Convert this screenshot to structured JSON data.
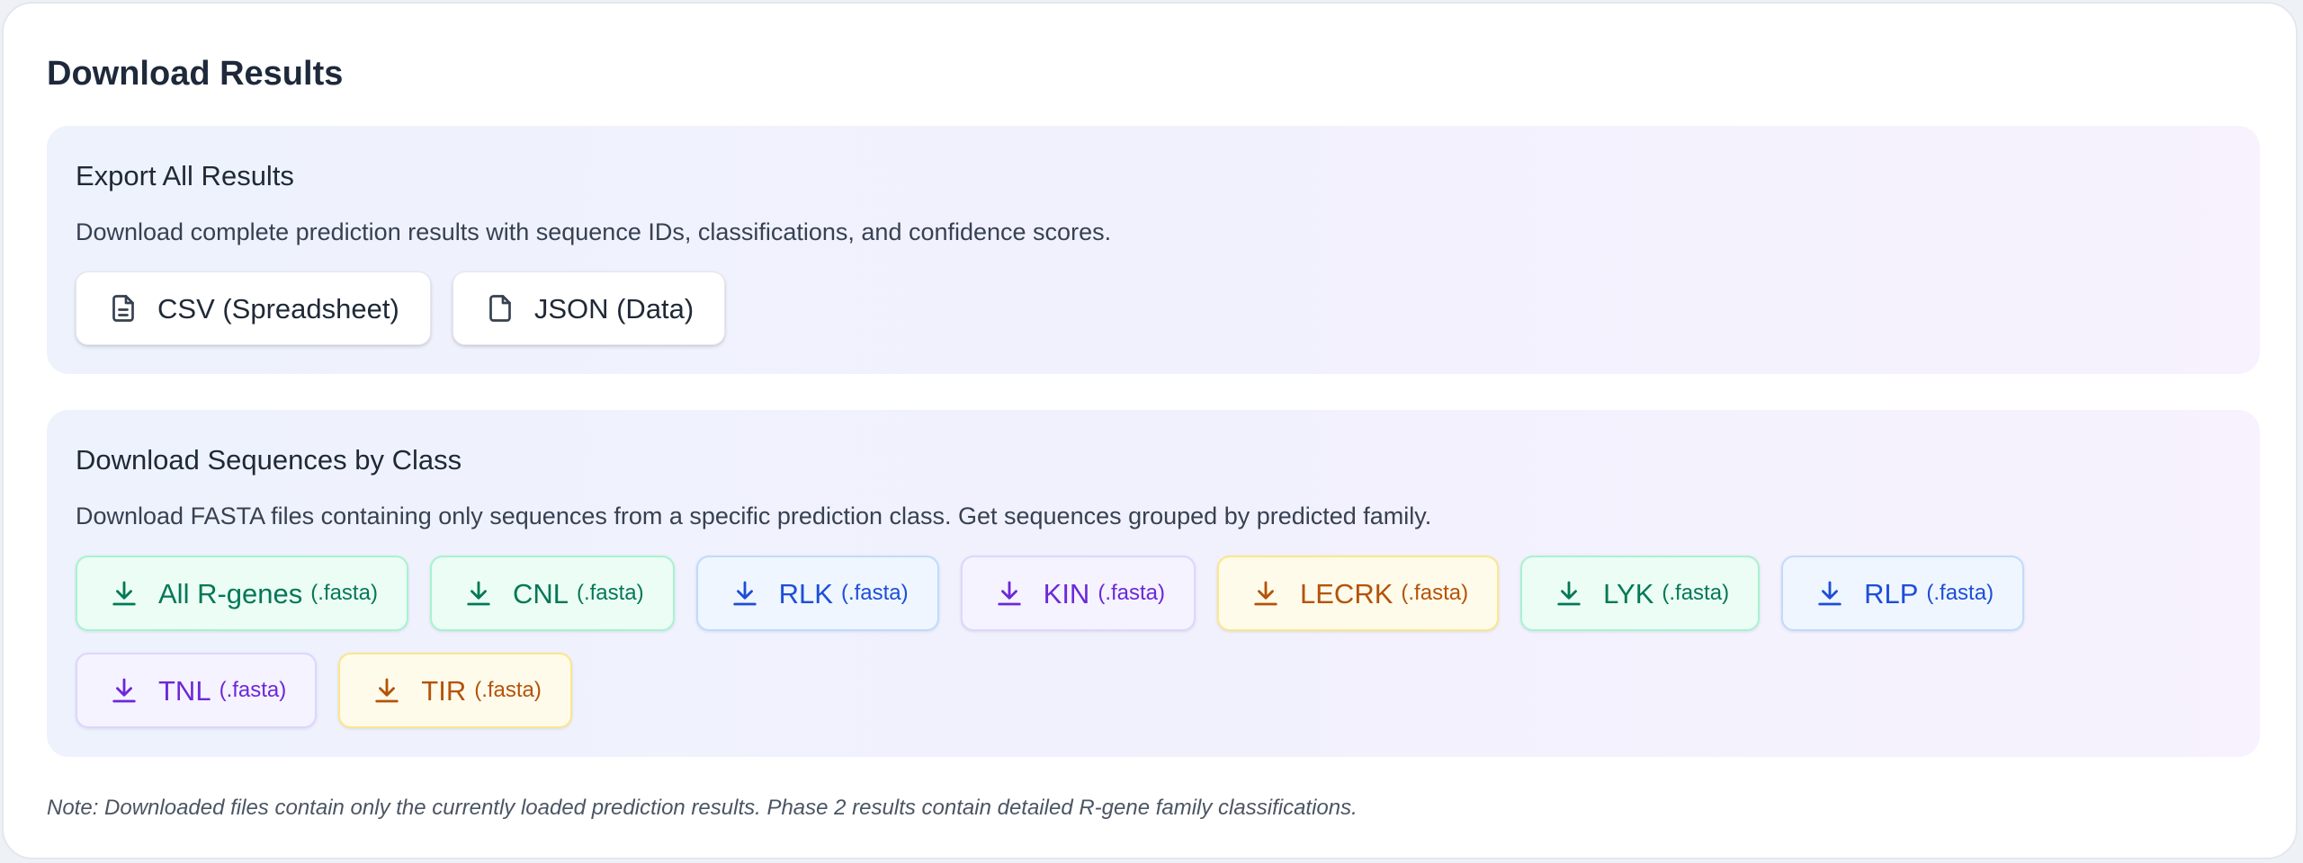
{
  "title": "Download Results",
  "export": {
    "heading": "Export All Results",
    "description": "Download complete prediction results with sequence IDs, classifications, and confidence scores.",
    "buttons": [
      {
        "label": "CSV (Spreadsheet)",
        "icon": "file-text-icon"
      },
      {
        "label": "JSON (Data)",
        "icon": "file-icon"
      }
    ]
  },
  "by_class": {
    "heading": "Download Sequences by Class",
    "description": "Download FASTA files containing only sequences from a specific prediction class. Get sequences grouped by predicted family.",
    "suffix": "(.fasta)",
    "buttons": [
      {
        "label": "All R-genes",
        "color": "#047857",
        "icon": "download-icon"
      },
      {
        "label": "CNL",
        "color": "#047857",
        "icon": "download-icon"
      },
      {
        "label": "RLK",
        "color": "#1d4ed8",
        "icon": "download-icon"
      },
      {
        "label": "KIN",
        "color": "#6d28d9",
        "icon": "download-icon"
      },
      {
        "label": "LECRK",
        "color": "#b45309",
        "icon": "download-icon"
      },
      {
        "label": "LYK",
        "color": "#047857",
        "icon": "download-icon"
      },
      {
        "label": "RLP",
        "color": "#1d4ed8",
        "icon": "download-icon"
      },
      {
        "label": "TNL",
        "color": "#6d28d9",
        "icon": "download-icon"
      },
      {
        "label": "TIR",
        "color": "#b45309",
        "icon": "download-icon"
      }
    ]
  },
  "note": "Note: Downloaded files contain only the currently loaded prediction results. Phase 2 results contain detailed R-gene family classifications."
}
